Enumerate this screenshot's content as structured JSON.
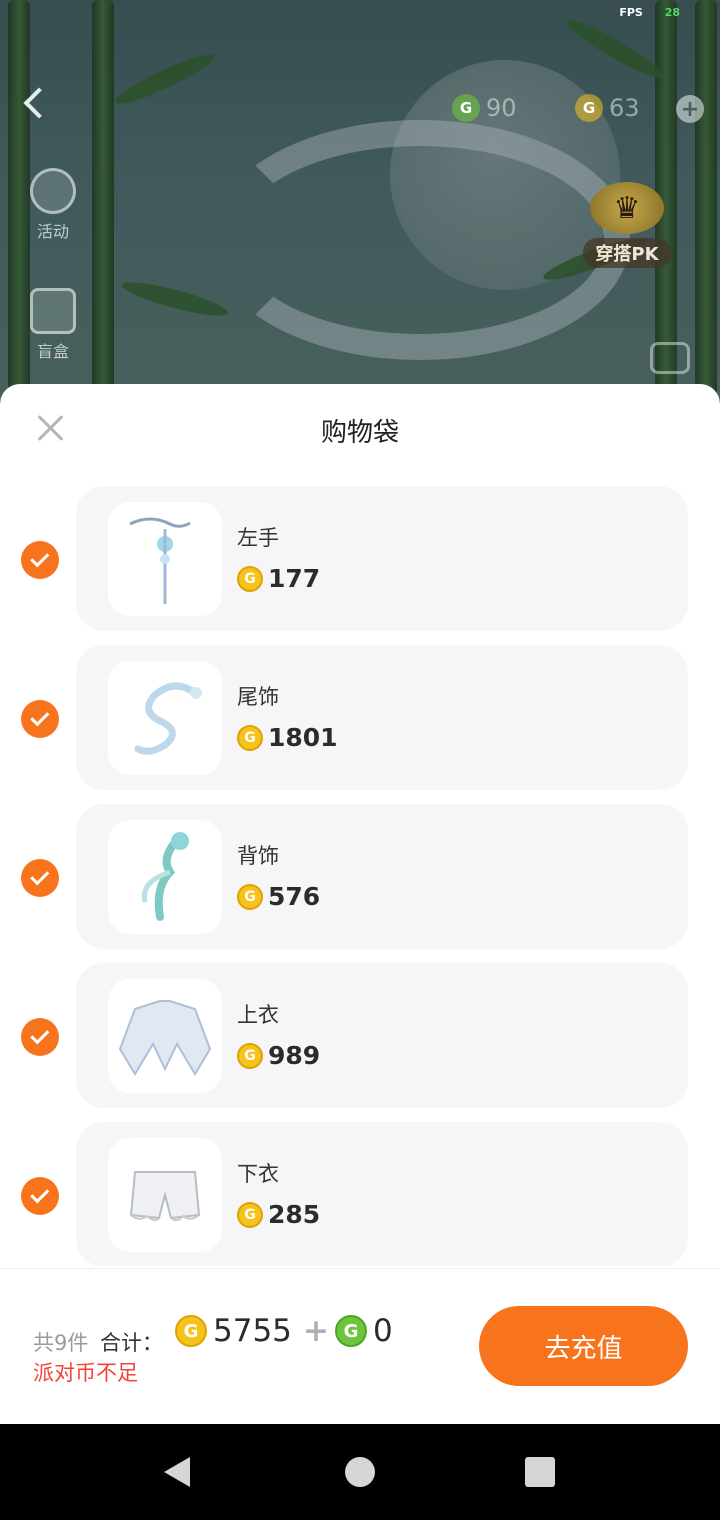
{
  "status": {
    "fps_label": "FPS",
    "fps_value": "28"
  },
  "hud": {
    "currency_green": "90",
    "currency_gold": "63",
    "side_buttons": [
      {
        "label": "活动",
        "icon": "lantern-icon"
      },
      {
        "label": "盲盒",
        "icon": "gift-box-icon"
      }
    ],
    "pk_label": "穿搭PK",
    "photo_label": "拍照"
  },
  "sheet": {
    "title": "购物袋",
    "items": [
      {
        "name": "左手",
        "price": "177",
        "checked": true,
        "icon": "wand-icon"
      },
      {
        "name": "尾饰",
        "price": "1801",
        "checked": true,
        "icon": "dragon-tail-icon"
      },
      {
        "name": "背饰",
        "price": "576",
        "checked": true,
        "icon": "flower-wings-icon"
      },
      {
        "name": "上衣",
        "price": "989",
        "checked": true,
        "icon": "ruffle-top-icon"
      },
      {
        "name": "下衣",
        "price": "285",
        "checked": true,
        "icon": "shorts-icon"
      }
    ],
    "footer": {
      "count_label": "共9件",
      "total_label": "合计：",
      "gold_total": "5755",
      "plus": "+",
      "green_total": "0",
      "warning": "派对币不足",
      "button_label": "去充值"
    }
  },
  "colors": {
    "accent": "#f7741d",
    "gold_coin": "#f6c21b",
    "green_coin": "#6cc53c",
    "warning": "#f44336"
  }
}
